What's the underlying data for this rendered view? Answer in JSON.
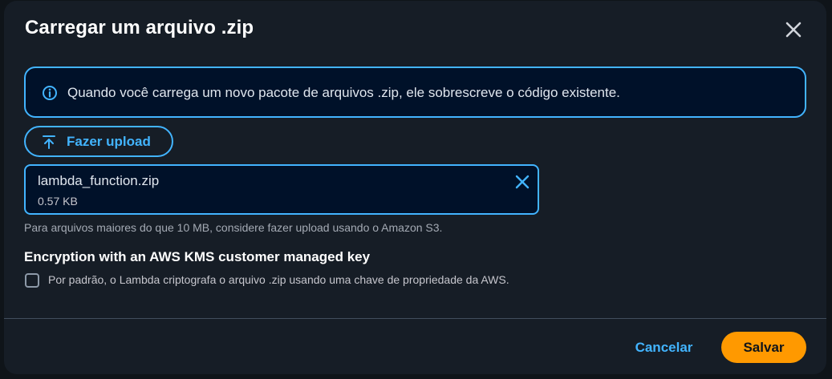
{
  "modal": {
    "title": "Carregar um arquivo .zip"
  },
  "alert": {
    "icon": "info-icon",
    "text": "Quando você carrega um novo pacote de arquivos .zip, ele sobrescreve o código existente."
  },
  "upload": {
    "icon": "upload-arrow-icon",
    "label": "Fazer upload"
  },
  "file": {
    "name": "lambda_function.zip",
    "size": "0.57 KB",
    "remove_icon": "close-icon"
  },
  "hint": "Para arquivos maiores do que 10 MB, considere fazer upload usando o Amazon S3.",
  "kms": {
    "heading": "Encryption with an AWS KMS customer managed key",
    "checkbox_label": "Por padrão, o Lambda criptografa o arquivo .zip usando uma chave de propriedade da AWS.",
    "checked": false
  },
  "footer": {
    "cancel_label": "Cancelar",
    "save_label": "Salvar"
  },
  "colors": {
    "accent": "#42b4ff",
    "primary_button": "#ff9900",
    "modal_background": "#161d26",
    "info_background": "#001129"
  }
}
